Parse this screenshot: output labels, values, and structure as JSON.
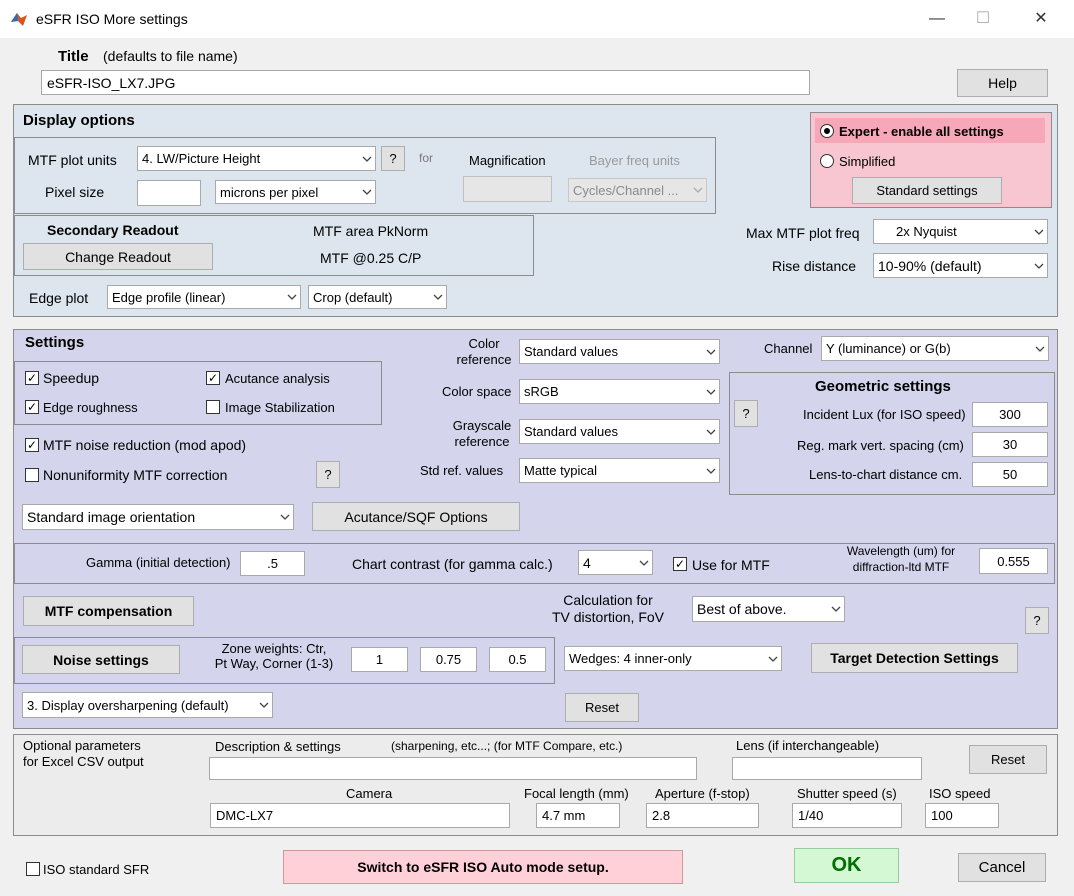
{
  "window": {
    "title": "eSFR ISO More settings"
  },
  "title_section": {
    "label": "Title",
    "hint": "(defaults to file name)",
    "value": "eSFR-ISO_LX7.JPG",
    "help": "Help"
  },
  "display": {
    "heading": "Display options",
    "mtf_plot_units_label": "MTF plot units",
    "mtf_plot_units_value": "4. LW/Picture Height",
    "q": "?",
    "for_label": "for",
    "magnification_label": "Magnification",
    "magnification_value": "",
    "bayer_label": "Bayer freq units",
    "bayer_value": "Cycles/Channel ...",
    "pixel_size_label": "Pixel size",
    "pixel_size_value": "",
    "pixel_unit_value": "microns per pixel",
    "secondary_title": "Secondary Readout",
    "change_readout": "Change Readout",
    "readout1": "MTF area PkNorm",
    "readout2": "MTF @0.25 C/P",
    "edge_plot_label": "Edge plot",
    "edge_plot_value": "Edge profile (linear)",
    "crop_value": "Crop (default)",
    "expert_label": "Expert - enable all settings",
    "simplified_label": "Simplified",
    "standard_settings": "Standard settings",
    "max_mtf_label": "Max MTF plot freq",
    "max_mtf_value": "2x Nyquist",
    "rise_label": "Rise distance",
    "rise_value": "10-90% (default)"
  },
  "settings": {
    "heading": "Settings",
    "speedup": "Speedup",
    "acutance": "Acutance analysis",
    "edge_roughness": "Edge roughness",
    "image_stab": "Image Stabilization",
    "mtf_noise": "MTF noise reduction (mod  apod)",
    "nonuniformity": "Nonuniformity MTF correction",
    "q": "?",
    "orientation_value": "Standard image orientation",
    "acutance_options": "Acutance/SQF Options",
    "color_ref_label1": "Color",
    "color_ref_label2": "reference",
    "color_ref_value": "Standard values",
    "color_space_label": "Color space",
    "color_space_value": "sRGB",
    "gray_ref_label1": "Grayscale",
    "gray_ref_label2": "reference",
    "gray_ref_value": "Standard values",
    "std_ref_label": "Std ref. values",
    "std_ref_value": "Matte typical",
    "channel_label": "Channel",
    "channel_value": "Y (luminance) or G(b)",
    "geo_title": "Geometric settings",
    "lux_label": "Incident Lux (for ISO speed)",
    "lux_value": "300",
    "reg_label": "Reg. mark vert. spacing (cm)",
    "reg_value": "30",
    "lens_chart_label": "Lens-to-chart distance cm.",
    "lens_chart_value": "50",
    "gamma_label": "Gamma (initial detection)",
    "gamma_value": ".5",
    "contrast_label": "Chart contrast (for gamma calc.)",
    "contrast_value": "4",
    "use_mtf": "Use for MTF",
    "wavelength_label1": "Wavelength (um) for",
    "wavelength_label2": "diffraction-ltd MTF",
    "wavelength_value": "0.555",
    "mtf_comp": "MTF compensation",
    "calc_label1": "Calculation for",
    "calc_label2": "TV distortion, FoV",
    "calc_value": "Best of above.",
    "noise_settings": "Noise settings",
    "zone_label1": "Zone weights:  Ctr,",
    "zone_label2": "Pt Way, Corner (1-3)",
    "zone1": "1",
    "zone2": "0.75",
    "zone3": "0.5",
    "wedges_value": "Wedges:  4 inner-only",
    "target_detection": "Target Detection Settings",
    "oversharp_value": "3. Display oversharpening (default)",
    "reset": "Reset"
  },
  "optional": {
    "label1": "Optional parameters",
    "label2": "for Excel CSV output",
    "desc_label": "Description & settings",
    "desc_hint": "(sharpening, etc...; (for MTF Compare, etc.)",
    "desc_value": "",
    "lens_label": "Lens (if interchangeable)",
    "lens_value": "",
    "reset": "Reset",
    "camera_label": "Camera",
    "camera_value": "DMC-LX7",
    "focal_label": "Focal length (mm)",
    "focal_value": "4.7 mm",
    "aperture_label": "Aperture (f-stop)",
    "aperture_value": "2.8",
    "shutter_label": "Shutter speed (s)",
    "shutter_value": "1/40",
    "iso_label": "ISO speed",
    "iso_value": "100"
  },
  "footer": {
    "iso_standard": "ISO standard SFR",
    "switch_auto": "Switch to eSFR ISO Auto mode setup.",
    "ok": "OK",
    "cancel": "Cancel"
  },
  "colors": {
    "display_bg": "#dde6ee",
    "settings_bg": "#d4d4ec",
    "expert_bg": "#f7c6d0",
    "ok_bg": "#d4f7d4",
    "ok_text": "#007000",
    "switch_bg": "#ffd0d8"
  }
}
